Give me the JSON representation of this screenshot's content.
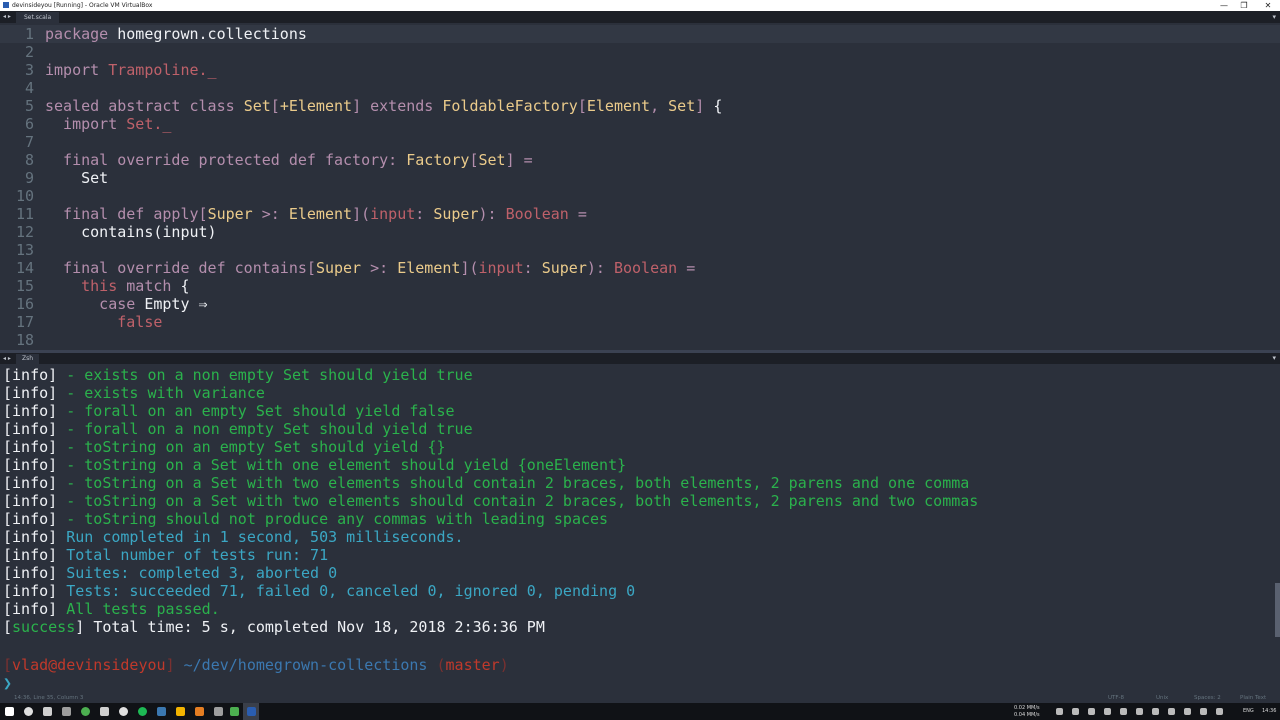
{
  "window": {
    "title": "devinsideyou [Running] - Oracle VM VirtualBox",
    "minimize": "—",
    "restore": "❐",
    "close": "✕"
  },
  "editor_tabbar": {
    "nav": "◂ ▸",
    "tab": "Set.scala",
    "menu": "▾"
  },
  "editor": {
    "lines": [
      {
        "n": "1",
        "tokens": [
          {
            "c": "kw",
            "t": "package "
          },
          {
            "c": "id",
            "t": "homegrown.collections"
          }
        ]
      },
      {
        "n": "2",
        "tokens": []
      },
      {
        "n": "3",
        "tokens": [
          {
            "c": "kw",
            "t": "import "
          },
          {
            "c": "pm",
            "t": "Trampoline._"
          }
        ]
      },
      {
        "n": "4",
        "tokens": []
      },
      {
        "n": "5",
        "tokens": [
          {
            "c": "kw",
            "t": "sealed abstract class "
          },
          {
            "c": "ty",
            "t": "Set"
          },
          {
            "c": "kw",
            "t": "["
          },
          {
            "c": "ty",
            "t": "+Element"
          },
          {
            "c": "kw",
            "t": "] extends "
          },
          {
            "c": "ty",
            "t": "FoldableFactory"
          },
          {
            "c": "kw",
            "t": "["
          },
          {
            "c": "ty",
            "t": "Element"
          },
          {
            "c": "kw",
            "t": ", "
          },
          {
            "c": "ty",
            "t": "Set"
          },
          {
            "c": "kw",
            "t": "] "
          },
          {
            "c": "id",
            "t": "{"
          }
        ]
      },
      {
        "n": "6",
        "tokens": [
          {
            "c": "kw",
            "t": "  import "
          },
          {
            "c": "pm",
            "t": "Set._"
          }
        ]
      },
      {
        "n": "7",
        "tokens": []
      },
      {
        "n": "8",
        "tokens": [
          {
            "c": "kw",
            "t": "  final override protected def "
          },
          {
            "c": "kw",
            "t": "factory: "
          },
          {
            "c": "ty",
            "t": "Factory"
          },
          {
            "c": "kw",
            "t": "["
          },
          {
            "c": "ty",
            "t": "Set"
          },
          {
            "c": "kw",
            "t": "] ="
          }
        ]
      },
      {
        "n": "9",
        "tokens": [
          {
            "c": "id",
            "t": "    Set"
          }
        ]
      },
      {
        "n": "10",
        "tokens": []
      },
      {
        "n": "11",
        "tokens": [
          {
            "c": "kw",
            "t": "  final def "
          },
          {
            "c": "kw",
            "t": "apply["
          },
          {
            "c": "ty",
            "t": "Super"
          },
          {
            "c": "kw",
            "t": " >: "
          },
          {
            "c": "ty",
            "t": "Element"
          },
          {
            "c": "kw",
            "t": "]("
          },
          {
            "c": "pm",
            "t": "input"
          },
          {
            "c": "kw",
            "t": ": "
          },
          {
            "c": "ty",
            "t": "Super"
          },
          {
            "c": "kw",
            "t": "): "
          },
          {
            "c": "pm",
            "t": "Boolean"
          },
          {
            "c": "kw",
            "t": " ="
          }
        ]
      },
      {
        "n": "12",
        "tokens": [
          {
            "c": "id",
            "t": "    contains(input)"
          }
        ]
      },
      {
        "n": "13",
        "tokens": []
      },
      {
        "n": "14",
        "tokens": [
          {
            "c": "kw",
            "t": "  final override def "
          },
          {
            "c": "kw",
            "t": "contains["
          },
          {
            "c": "ty",
            "t": "Super"
          },
          {
            "c": "kw",
            "t": " >: "
          },
          {
            "c": "ty",
            "t": "Element"
          },
          {
            "c": "kw",
            "t": "]("
          },
          {
            "c": "pm",
            "t": "input"
          },
          {
            "c": "kw",
            "t": ": "
          },
          {
            "c": "ty",
            "t": "Super"
          },
          {
            "c": "kw",
            "t": "): "
          },
          {
            "c": "pm",
            "t": "Boolean"
          },
          {
            "c": "kw",
            "t": " ="
          }
        ]
      },
      {
        "n": "15",
        "tokens": [
          {
            "c": "pm",
            "t": "    this "
          },
          {
            "c": "kw",
            "t": "match "
          },
          {
            "c": "id",
            "t": "{"
          }
        ]
      },
      {
        "n": "16",
        "tokens": [
          {
            "c": "kw",
            "t": "      case "
          },
          {
            "c": "id",
            "t": "Empty ⇒"
          }
        ]
      },
      {
        "n": "17",
        "tokens": [
          {
            "c": "pm",
            "t": "        false"
          }
        ]
      },
      {
        "n": "18",
        "tokens": []
      }
    ]
  },
  "terminal_tabbar": {
    "nav": "◂ ▸",
    "tab": "Zsh",
    "menu": "▾"
  },
  "terminal": {
    "lines": [
      {
        "tag": "info",
        "style": "green",
        "msg": "- exists on a non empty Set should yield true"
      },
      {
        "tag": "info",
        "style": "green",
        "msg": "- exists with variance"
      },
      {
        "tag": "info",
        "style": "green",
        "msg": "- forall on an empty Set should yield false"
      },
      {
        "tag": "info",
        "style": "green",
        "msg": "- forall on a non empty Set should yield true"
      },
      {
        "tag": "info",
        "style": "green",
        "msg": "- toString on an empty Set should yield {}"
      },
      {
        "tag": "info",
        "style": "green",
        "msg": "- toString on a Set with one element should yield {oneElement}"
      },
      {
        "tag": "info",
        "style": "green",
        "msg": "- toString on a Set with two elements should contain 2 braces, both elements, 2 parens and one comma"
      },
      {
        "tag": "info",
        "style": "green",
        "msg": "- toString on a Set with two elements should contain 2 braces, both elements, 2 parens and two commas"
      },
      {
        "tag": "info",
        "style": "green",
        "msg": "- toString should not produce any commas with leading spaces"
      },
      {
        "tag": "info",
        "style": "cyan",
        "msg": "Run completed in 1 second, 503 milliseconds."
      },
      {
        "tag": "info",
        "style": "cyan",
        "msg": "Total number of tests run: 71"
      },
      {
        "tag": "info",
        "style": "cyan",
        "msg": "Suites: completed 3, aborted 0"
      },
      {
        "tag": "info",
        "style": "cyan",
        "msg": "Tests: succeeded 71, failed 0, canceled 0, ignored 0, pending 0"
      },
      {
        "tag": "info",
        "style": "green",
        "msg": "All tests passed."
      },
      {
        "tag": "success",
        "style": "white",
        "msg": "Total time: 5 s, completed Nov 18, 2018 2:36:36 PM"
      }
    ],
    "prompt": {
      "user": "vlad@devinsideyou",
      "path": "~/dev/homegrown-collections",
      "branch": "master",
      "cursor": "❯"
    }
  },
  "statusbar": {
    "position": "14:36, Line 35, Column 3",
    "encoding": "UTF-8",
    "line_endings": "Unix",
    "indent": "Spaces: 2",
    "syntax": "Plain Text"
  },
  "taskbar": {
    "net_up": "0.02 MM/s",
    "net_down": "0.04 MM/s",
    "lang": "ENG",
    "clock": "14:36"
  },
  "colors": {
    "editor_bg": "#2b303b",
    "keyword": "#b48ead",
    "type": "#ebcb8b",
    "param": "#bf616a",
    "success_green": "#2bb24c",
    "info_cyan": "#3ba7c4"
  }
}
